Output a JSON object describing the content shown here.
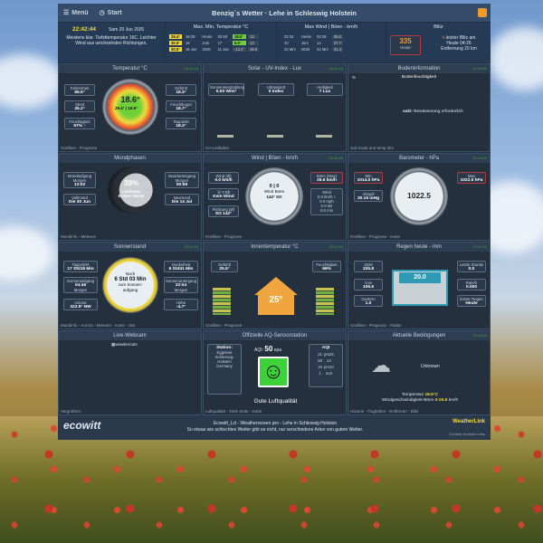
{
  "app": {
    "menu": "Menü",
    "start": "Start",
    "title": "Benzig`s Wetter  ·  Lehe in Schleswig Holstein"
  },
  "top": {
    "time": "22:42:44",
    "date": "Sam 20 Jun 2026",
    "forecast": "Meistens klar. Tiefsttemperatur 16C. Leichter Wind aus wechselnden Richtungen.",
    "temp_hdr": "Max. Min. Temperatur °C",
    "wind_hdr": "Max Wind | Böen - km/h",
    "blitz_hdr": "Blitz",
    "temp_rows": [
      [
        "29.4°",
        "16:29",
        "Heute",
        "02:59",
        "18.5°",
        "13"
      ],
      [
        "30.5°",
        "19",
        "Juni",
        "17",
        "6.0°",
        "13"
      ],
      [
        "30.5°",
        "19 Jun",
        "2026",
        "11 Jan",
        "-13.2°",
        "19.5"
      ]
    ],
    "wind_rows": [
      [
        "02:34",
        "Heute",
        "02:29",
        "25.6"
      ],
      [
        "20",
        "Juni",
        "14",
        "27.7"
      ],
      [
        "22 Mrz",
        "2026",
        "22 Mrz",
        "31.4"
      ]
    ],
    "blitz_count": "335",
    "blitz_sub": "Heute",
    "blitz_txt1": "letzter Blitz am",
    "blitz_txt2": "Heute 04:26",
    "blitz_txt3": "Entfernung 20 km"
  },
  "temp": {
    "hdr": "Temperatur °C",
    "ts": "22:42:40",
    "value": "18.6°",
    "hi": "29.4°",
    "lo": "18.5°",
    "fuehl_l": "Fahrenheit",
    "fuehl_v": "65.5°",
    "streit_l": "Streit",
    "streit_v": "25.2°",
    "feucht_l": "Feuchtigkeit",
    "feucht_v": "57% ↑",
    "gefuehlt_l": "Gefühlt",
    "gefuehlt_v": "18.3°",
    "feuchtk_l": "Feuchtkugel",
    "feuchtk_v": "18.7°",
    "taupunkt_l": "Taupunkt",
    "taupunkt_v": "18.3°",
    "ftr": "Grafiken - Prognose"
  },
  "solar": {
    "hdr": "Solar - UV-Index - Lux",
    "ts": "22:42:40",
    "a_l": "Sonneneinstrahlung",
    "a_v": "0.00 W/m²",
    "b_l": "Ultraviolett",
    "b_v": "0 Index",
    "c_l": "Helligkeit",
    "c_v": "7 Lux",
    "ftr": "UV-Leitfaden"
  },
  "boden": {
    "hdr": "Bodeninformation",
    "ts": "22:42:40",
    "sub": "Bodenfeuchtigkeit",
    "pct": "%",
    "value": "sakt",
    "txt": "Bewässerung erforderlich",
    "ftr": "Soil moist and temp info"
  },
  "moon": {
    "hdr": "Mondphasen",
    "pct": "39%",
    "phase": "Luminanz",
    "phase2": "Erstes Viertel",
    "a_l": "Mondaufgang",
    "a_v1": "Morgen",
    "a_v2": "13:02",
    "b_l": "Vollmond",
    "b_v": "Die 30 Jun",
    "c_l": "Monduntergang",
    "c_v1": "Morgen",
    "c_v2": "00:59",
    "d_l": "Neumond",
    "d_v": "Die 14 Jul",
    "ftr": "Mondinfo - Meteore"
  },
  "wind": {
    "hdr": "Wind | Böen - km/h",
    "ts": "22:42:40",
    "a_l": "Wind (Ø)",
    "a_v": "0.0 km/h",
    "b_l": "⦿ 0 Bft",
    "b_v": "Kein Wind",
    "c_l": "Richtung (Ø)",
    "c_v": "SO 142°",
    "d_l": "Böen (Max)",
    "d_v": "25.6 km/h",
    "e_l": "Wind",
    "e_v": "0.0 km/h +",
    "f_v": "0.0 mph",
    "g_v": "0.0 kts",
    "h_v": "0.0 m/s",
    "center_w": "0",
    "center_b": "0",
    "center_wl": "Wind",
    "center_bl": "Böen",
    "dir": "142° SO",
    "ftr": "Grafiken - Prognose"
  },
  "baro": {
    "hdr": "Barometer - hPa",
    "ts": "22:42:40",
    "value": "1022.5",
    "a_l": "Min",
    "a_v": "1014.0 hPa",
    "b_l": "Aktuell",
    "b_v": "30.19 inHg",
    "c_l": "Max",
    "c_v": "1022.5 hPa",
    "ftr": "Grafiken - Prognose - Karte"
  },
  "sun": {
    "hdr": "Sonnenstand",
    "ts": "22:42:40",
    "a_l": "Tageslicht",
    "a_v": "17 Std18 Min",
    "b_l": "Sonnenaufgang",
    "b_v1": "04:46",
    "b_v2": "Morgen",
    "c_l": "Azimut",
    "c_v": "322.9° NW",
    "d_l": "Dunkelheit",
    "d_v": "6 Std41 Min",
    "e_l": "Sonnenuntergang",
    "e_v1": "22:04",
    "e_v2": "Morgen",
    "f_l": "Höhe",
    "f_v": "-4.7°",
    "center1": "Noch",
    "center2": "6 Std 03 Min",
    "center3": "zum Sonnen-aufgang",
    "ftr": "Mondinfo - Aurora - Meteore - Karte - ISS"
  },
  "indoor": {
    "hdr": "Innentemperatur °C",
    "ts": "22:42:40",
    "value": "25°",
    "a_l": "Gefühlt",
    "a_v": "25.5°",
    "b_l": "Feuchtigkeit",
    "b_v": "66%",
    "ftr": "Grafiken - Prognose"
  },
  "rain": {
    "hdr": "Regen heute - mm",
    "ts": "22:42:40",
    "value": "20.0",
    "a_l": "2026",
    "a_v": "335.8",
    "b_l": "Juni",
    "b_v": "106.6",
    "c_l": "Gestern",
    "c_v": "1.0",
    "d_l": "Letzte Stunde",
    "d_v": "0.0",
    "e_l": "Rate/h",
    "e_v": "0.000",
    "f_l": "letzter Regen",
    "f_v": "Heute",
    "ftr": "Grafiken - Prognose - Radar"
  },
  "webcam": {
    "hdr": "Live-Webcam",
    "img": "weathercam",
    "ftr": "Vergrößern"
  },
  "aq": {
    "hdr": "Offizielle AQ-Sensorstation",
    "station_l": "Station:",
    "station": "Eggebek Schleswig-Holstein Germany",
    "aqi_l": "AQI:",
    "aqi_v": "50",
    "aqi_u": "epa",
    "table_h": "AQI",
    "rows": [
      [
        "21",
        "pm25"
      ],
      [
        "50",
        "o3"
      ],
      [
        "10",
        "pm10"
      ],
      [
        "1",
        "no2"
      ]
    ],
    "status": "Gute Luftqualität",
    "ftr": "Luftqualität - Viele Seite - Karte"
  },
  "cond": {
    "hdr": "Aktuelle Bedingungen",
    "ts": "22:42:40",
    "state": "Unknown",
    "t_l": "Temperatur",
    "t_v": "18.6°C",
    "w_l": "Windgeschwindigkeit-Böen",
    "w_v": "0-25.6",
    "w_u": "km/h",
    "ftr": "Historie - Flughafen - Entfernen - Blitz"
  },
  "footer": {
    "logo": "ecowitt",
    "line1": "Ecowitt_Lcl  -  Weatherscreen pro  -  Lehe in Schleswig Holstein",
    "line2": "So etwas wie schlechtes Wetter gibt es nicht, nur verschiedene Arten von gutem Wetter.",
    "right_logo": "WeatherLink",
    "right_sub": "Cookies  Kontakt  Links"
  },
  "colors": {
    "accent": "#f1d93d",
    "green": "#6fd13a",
    "red": "#b6373c"
  }
}
